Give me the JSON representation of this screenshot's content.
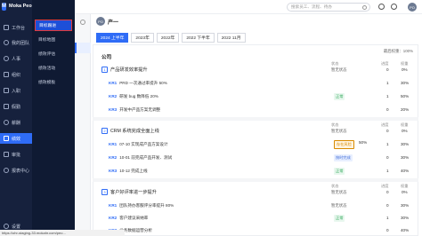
{
  "app": {
    "brand": "Moka People",
    "logo_letter": "M"
  },
  "sidebar": {
    "items": [
      {
        "label": "工作台",
        "icon": "home-icon"
      },
      {
        "label": "我的团队",
        "icon": "team-icon"
      },
      {
        "label": "人事",
        "icon": "person-icon"
      },
      {
        "label": "组织",
        "icon": "org-icon"
      },
      {
        "label": "入职",
        "icon": "onboard-icon"
      },
      {
        "label": "假勤",
        "icon": "calendar-icon"
      },
      {
        "label": "薪酬",
        "icon": "money-icon"
      },
      {
        "label": "绩效",
        "icon": "performance-icon"
      },
      {
        "label": "审批",
        "icon": "approval-icon"
      },
      {
        "label": "报表中心",
        "icon": "report-icon"
      },
      {
        "label": "设置",
        "icon": "gear-icon"
      }
    ]
  },
  "subnav": {
    "items": [
      {
        "label": "目标跟进"
      },
      {
        "label": "目标地图"
      },
      {
        "label": "绩效评估"
      },
      {
        "label": "绩效活动"
      },
      {
        "label": "绩效模板"
      }
    ]
  },
  "topbar": {
    "search_placeholder": "搜索员工、流程、待办"
  },
  "user": {
    "name": "产一",
    "avatar": "PO"
  },
  "tabs": [
    {
      "label": "2024 上半年",
      "active": true
    },
    {
      "label": "2023年",
      "active": false
    },
    {
      "label": "2022年",
      "active": false
    },
    {
      "label": "2022 下半年",
      "active": false
    },
    {
      "label": "2022 11月",
      "active": false
    }
  ],
  "card": {
    "weight_label": "最后权重：100%",
    "title": "公司"
  },
  "columns": {
    "status": "状态",
    "progress": "进度",
    "weight": "权重"
  },
  "objectives": [
    {
      "num": "1",
      "title": "产品研发效率提升",
      "status": "暂无状态",
      "progress": "0",
      "weight": "0%",
      "krs": [
        {
          "tag": "KR1",
          "text": "PRD 一次通过率提升 50%",
          "status": "",
          "progress": "1",
          "weight": "30%"
        },
        {
          "tag": "KR2",
          "text": "研发 bug 数降低 20%",
          "status": "正常",
          "status_kind": "normal",
          "progress": "1",
          "weight": "50%"
        },
        {
          "tag": "KR3",
          "text": "开发中产品方案无调整",
          "status": "",
          "progress": "0",
          "weight": "20%"
        }
      ]
    },
    {
      "num": "2",
      "title": "CRM 系统完成全面上线",
      "status": "暂无状态",
      "progress": "0",
      "weight": "0%",
      "krs": [
        {
          "tag": "KR1",
          "text": "07-10 实现成产品方案设计",
          "status": "存在风险",
          "status_kind": "risk",
          "progress_pct": 50,
          "progress_text": "50%",
          "progress": "1",
          "weight": "30%"
        },
        {
          "tag": "KR2",
          "text": "10-01 前完成产品开发、测试",
          "status": "按时完成",
          "status_kind": "sched",
          "progress": "0",
          "weight": "30%"
        },
        {
          "tag": "KR3",
          "text": "10-12 完成上线",
          "status": "正常",
          "status_kind": "normal",
          "progress": "1",
          "weight": "40%"
        }
      ]
    },
    {
      "num": "3",
      "title": "客户好评率进一步提升",
      "status": "暂无状态",
      "progress": "0",
      "weight": "0%",
      "krs": [
        {
          "tag": "KR1",
          "text": "团队持办客服评分率提升 80%",
          "status": "暂无状态",
          "status_kind": "",
          "progress": "0",
          "weight": "30%"
        },
        {
          "tag": "KR2",
          "text": "客户建议采纳率",
          "status": "正常",
          "status_kind": "normal",
          "progress": "1",
          "weight": "30%"
        },
        {
          "tag": "KR3",
          "text": "业务数据运营分析",
          "status": "",
          "progress": "0",
          "weight": "40%"
        }
      ]
    }
  ],
  "statusbar": {
    "url": "https://ohr-staging-33.mokahr.com/peo..."
  }
}
